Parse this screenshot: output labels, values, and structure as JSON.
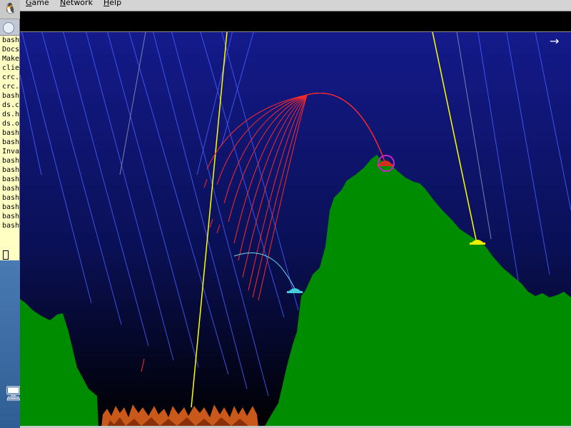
{
  "menubar": {
    "items": [
      {
        "label": "Game"
      },
      {
        "label": "Network"
      },
      {
        "label": "Help"
      }
    ]
  },
  "terminal": {
    "lines": [
      "bash",
      "Docs",
      "Make",
      "clie",
      "crc.",
      "crc.",
      "bash",
      "ds.c",
      "ds.h",
      "ds.o",
      "bash",
      "bash",
      "Inva",
      "bash",
      "bash",
      "bash",
      "bash",
      "bash",
      "bash",
      "bash",
      "bash"
    ]
  },
  "game": {
    "scroll_arrow": "→",
    "colors": {
      "sky_top": "#0f177a",
      "sky_bottom": "#000000",
      "terrain": "#008c00",
      "laser": "#ffff00",
      "rain": "#4a5cff",
      "red_trajectory": "#ff2222",
      "cyan_trajectory": "#66ddee",
      "target_ring": "#cc22cc",
      "fire": "#c85a10"
    },
    "tanks": [
      {
        "name": "red-tank",
        "color": "#d03020",
        "targeted": true
      },
      {
        "name": "yellow-tank",
        "color": "#eeee00",
        "targeted": false
      },
      {
        "name": "cyan-tank",
        "color": "#44ccdd",
        "targeted": false
      }
    ],
    "icons": [
      "tux-icon",
      "computer-icon",
      "right-arrow-icon"
    ]
  }
}
